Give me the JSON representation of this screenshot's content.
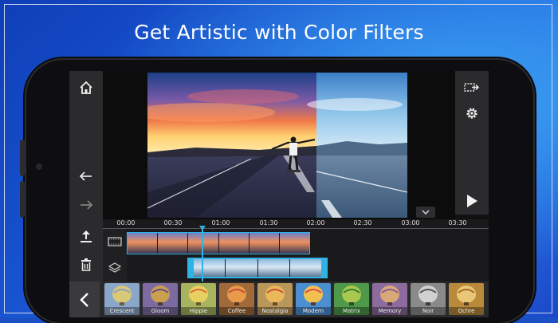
{
  "headline": "Get Artistic with Color Filters",
  "left_toolbar": {
    "home": "home-icon",
    "undo": "undo-icon",
    "redo": "redo-icon",
    "export": "upload-icon",
    "delete": "trash-icon"
  },
  "right_toolbar": {
    "produce": "export-arrow-icon",
    "settings": "gear-icon",
    "play": "play-icon"
  },
  "timeline": {
    "ruler": [
      "00:00",
      "00:30",
      "01:00",
      "01:30",
      "02:00",
      "02:30",
      "03:00",
      "03:30"
    ]
  },
  "filters": [
    {
      "label": "Crescent",
      "color": "#8aa6c8"
    },
    {
      "label": "Gloom",
      "color": "#7d6aa0"
    },
    {
      "label": "Hippie",
      "color": "#a7b35e"
    },
    {
      "label": "Coffee",
      "color": "#a06a3a"
    },
    {
      "label": "Nostalgia",
      "color": "#b9965a"
    },
    {
      "label": "Modern",
      "color": "#4c8fd1"
    },
    {
      "label": "Matrix",
      "color": "#4e9a4a"
    },
    {
      "label": "Memory",
      "color": "#8d6b9e"
    },
    {
      "label": "Noir",
      "color": "#8a8a8a"
    },
    {
      "label": "Ochre",
      "color": "#b88a3a"
    }
  ],
  "colors": {
    "accent": "#2fb3e6",
    "background": "#1b4fc4"
  }
}
